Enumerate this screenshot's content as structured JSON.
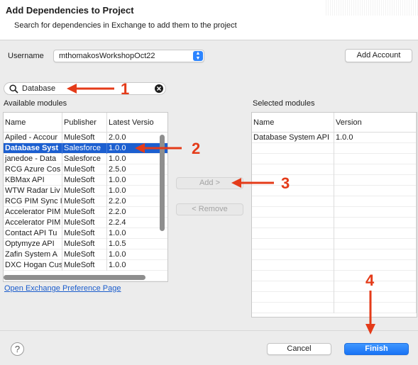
{
  "dialog": {
    "title": "Add Dependencies to Project",
    "subtitle": "Search for dependencies in Exchange to add them to the project"
  },
  "username": {
    "label": "Username",
    "selected": "mthomakosWorkshopOct22",
    "add_account_label": "Add Account"
  },
  "search": {
    "value": "Database"
  },
  "available": {
    "label": "Available modules",
    "columns": [
      "Name",
      "Publisher",
      "Latest Versio"
    ],
    "rows": [
      {
        "name": "Apiled - Accour",
        "publisher": "MuleSoft",
        "version": "2.0.0"
      },
      {
        "name": "Database Syst",
        "publisher": "Salesforce",
        "version": "1.0.0"
      },
      {
        "name": "janedoe - Data",
        "publisher": "Salesforce",
        "version": "1.0.0"
      },
      {
        "name": "RCG Azure Cos",
        "publisher": "MuleSoft",
        "version": "2.5.0"
      },
      {
        "name": "KBMax API",
        "publisher": "MuleSoft",
        "version": "1.0.0"
      },
      {
        "name": "WTW Radar Liv",
        "publisher": "MuleSoft",
        "version": "1.0.0"
      },
      {
        "name": "RCG PIM Sync I",
        "publisher": "MuleSoft",
        "version": "2.2.0"
      },
      {
        "name": "Accelerator PIM",
        "publisher": "MuleSoft",
        "version": "2.2.0"
      },
      {
        "name": "Accelerator PIM",
        "publisher": "MuleSoft",
        "version": "2.2.4"
      },
      {
        "name": "Contact API Tu",
        "publisher": "MuleSoft",
        "version": "1.0.0"
      },
      {
        "name": "Optymyze API",
        "publisher": "MuleSoft",
        "version": "1.0.5"
      },
      {
        "name": "Zafin System A",
        "publisher": "MuleSoft",
        "version": "1.0.0"
      },
      {
        "name": "DXC Hogan Cus",
        "publisher": "MuleSoft",
        "version": "1.0.0"
      }
    ],
    "selected_row_index": 1,
    "exchange_link": "Open Exchange Preference Page"
  },
  "actions": {
    "add_label": "Add >",
    "remove_label": "< Remove"
  },
  "selected": {
    "label": "Selected modules",
    "columns": [
      "Name",
      "Version"
    ],
    "rows": [
      {
        "name": "Database System API",
        "version": "1.0.0"
      }
    ]
  },
  "footer": {
    "cancel_label": "Cancel",
    "finish_label": "Finish"
  },
  "annotations": [
    "1",
    "2",
    "3",
    "4"
  ],
  "colors": {
    "accent": "#2c84ff",
    "selection": "#1c5fd0",
    "annotation": "#e43b19",
    "link": "#1a5ccc"
  }
}
